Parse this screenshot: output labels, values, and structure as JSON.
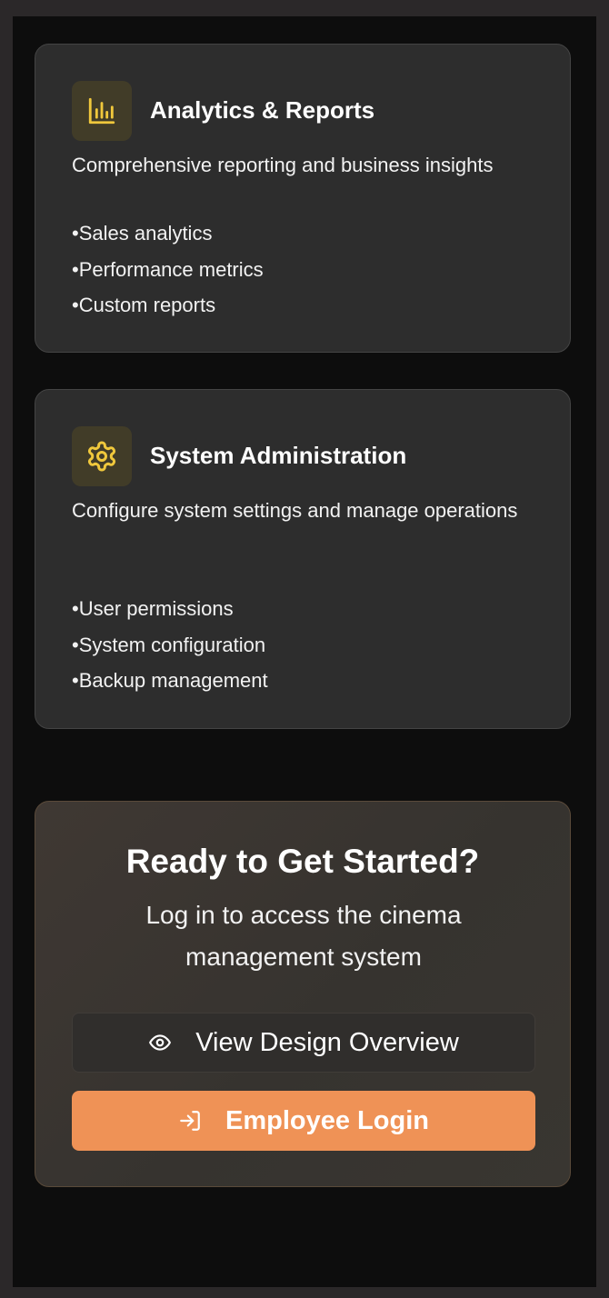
{
  "features": [
    {
      "icon": "bar-chart-icon",
      "title": "Analytics & Reports",
      "description": "Comprehensive reporting and business insights",
      "bullets": [
        "Sales analytics",
        "Performance metrics",
        "Custom reports"
      ]
    },
    {
      "icon": "gear-icon",
      "title": "System Administration",
      "description": "Configure system settings and manage operations",
      "bullets": [
        "User permissions",
        "System configuration",
        "Backup management"
      ]
    }
  ],
  "cta": {
    "title": "Ready to Get Started?",
    "subtitle": "Log in to access the cinema management system",
    "overview_button": {
      "icon": "eye-icon",
      "label": "View Design Overview"
    },
    "login_button": {
      "icon": "log-in-icon",
      "label": "Employee Login"
    }
  },
  "colors": {
    "accent": "#ef9256",
    "icon_yellow": "#f0c83c",
    "card_bg": "#2d2d2d",
    "page_bg": "#0d0d0d"
  }
}
